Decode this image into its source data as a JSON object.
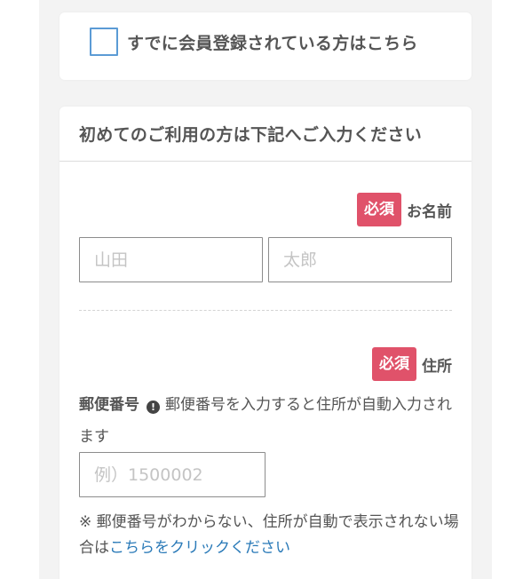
{
  "member": {
    "label": "すでに会員登録されている方はこちら"
  },
  "form": {
    "header": "初めてのご利用の方は下記へご入力ください",
    "name_field": {
      "required_badge": "必須",
      "label": "お名前",
      "last_name_placeholder": "山田",
      "first_name_placeholder": "太郎"
    },
    "address_field": {
      "required_badge": "必須",
      "label": "住所",
      "postal_label": "郵便番号",
      "postal_info_icon": "info-icon",
      "postal_help": "郵便番号を入力すると住所が自動入力されます",
      "postal_placeholder": "例）1500002",
      "note_prefix": "※ 郵便番号がわからない、住所が自動で表示されない場合は",
      "note_link": "こちらをクリックください"
    }
  },
  "colors": {
    "required_badge": "#e0526a",
    "link": "#2a7ab8",
    "checkbox_border": "#5b9bd5",
    "page_background": "#f3f3f3"
  }
}
